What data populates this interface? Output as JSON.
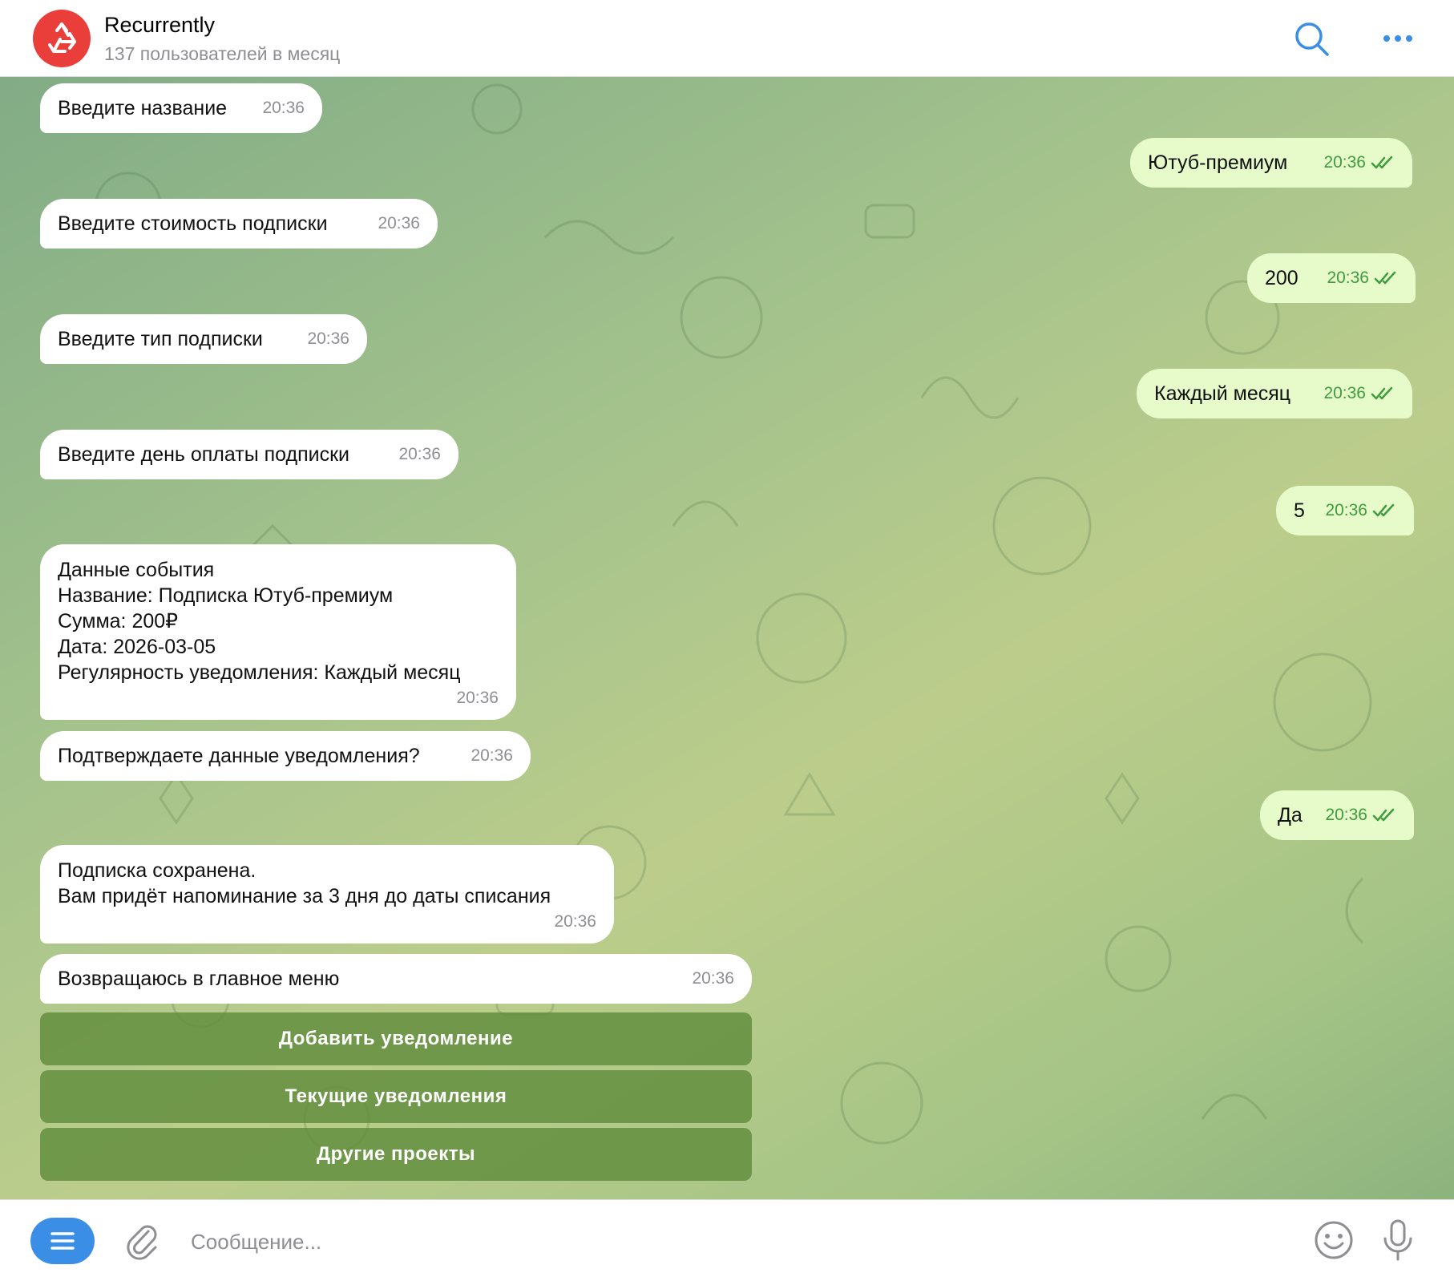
{
  "header": {
    "title": "Recurrently",
    "subtitle": "137 пользователей в месяц",
    "avatar_color": "#e93e3a"
  },
  "messages": [
    {
      "direction": "in",
      "text": "Введите название",
      "time": "20:36"
    },
    {
      "direction": "out",
      "text": "Ютуб-премиум",
      "time": "20:36",
      "status": "read"
    },
    {
      "direction": "in",
      "text": "Введите стоимость подписки",
      "time": "20:36"
    },
    {
      "direction": "out",
      "text": "200",
      "time": "20:36",
      "status": "read"
    },
    {
      "direction": "in",
      "text": "Введите тип подписки",
      "time": "20:36"
    },
    {
      "direction": "out",
      "text": "Каждый месяц",
      "time": "20:36",
      "status": "read"
    },
    {
      "direction": "in",
      "text": "Введите день оплаты подписки",
      "time": "20:36"
    },
    {
      "direction": "out",
      "text": "5",
      "time": "20:36",
      "status": "read"
    },
    {
      "direction": "in",
      "lines": [
        "Данные события",
        "Название: Подписка Ютуб-премиум",
        "Сумма: 200₽",
        "Дата: 2026-03-05",
        "Регулярность уведомления: Каждый месяц"
      ],
      "time": "20:36"
    },
    {
      "direction": "in",
      "text": "Подтверждаете данные уведомления?",
      "time": "20:36"
    },
    {
      "direction": "out",
      "text": "Да",
      "time": "20:36",
      "status": "read"
    },
    {
      "direction": "in",
      "lines": [
        "Подписка сохранена.",
        "Вам придёт напоминание за 3 дня до даты списания"
      ],
      "time": "20:36"
    },
    {
      "direction": "in",
      "text": "Возвращаюсь в главное меню",
      "time": "20:36"
    }
  ],
  "keyboard": {
    "buttons": [
      "Добавить уведомление",
      "Текущие уведомления",
      "Другие проекты"
    ]
  },
  "composer": {
    "placeholder": "Сообщение..."
  },
  "icons": {
    "avatar": "recycle-icon",
    "search": "search-icon",
    "more": "more-icon",
    "menu": "menu-icon",
    "attach": "paperclip-icon",
    "emoji": "emoji-icon",
    "mic": "microphone-icon",
    "read_status": "double-check-icon"
  },
  "colors": {
    "accent": "#3a8ee6",
    "outgoing_bubble": "#e6fbc9",
    "read_check": "#3f9b3f",
    "keyboard_button": "#6a9a4a"
  }
}
